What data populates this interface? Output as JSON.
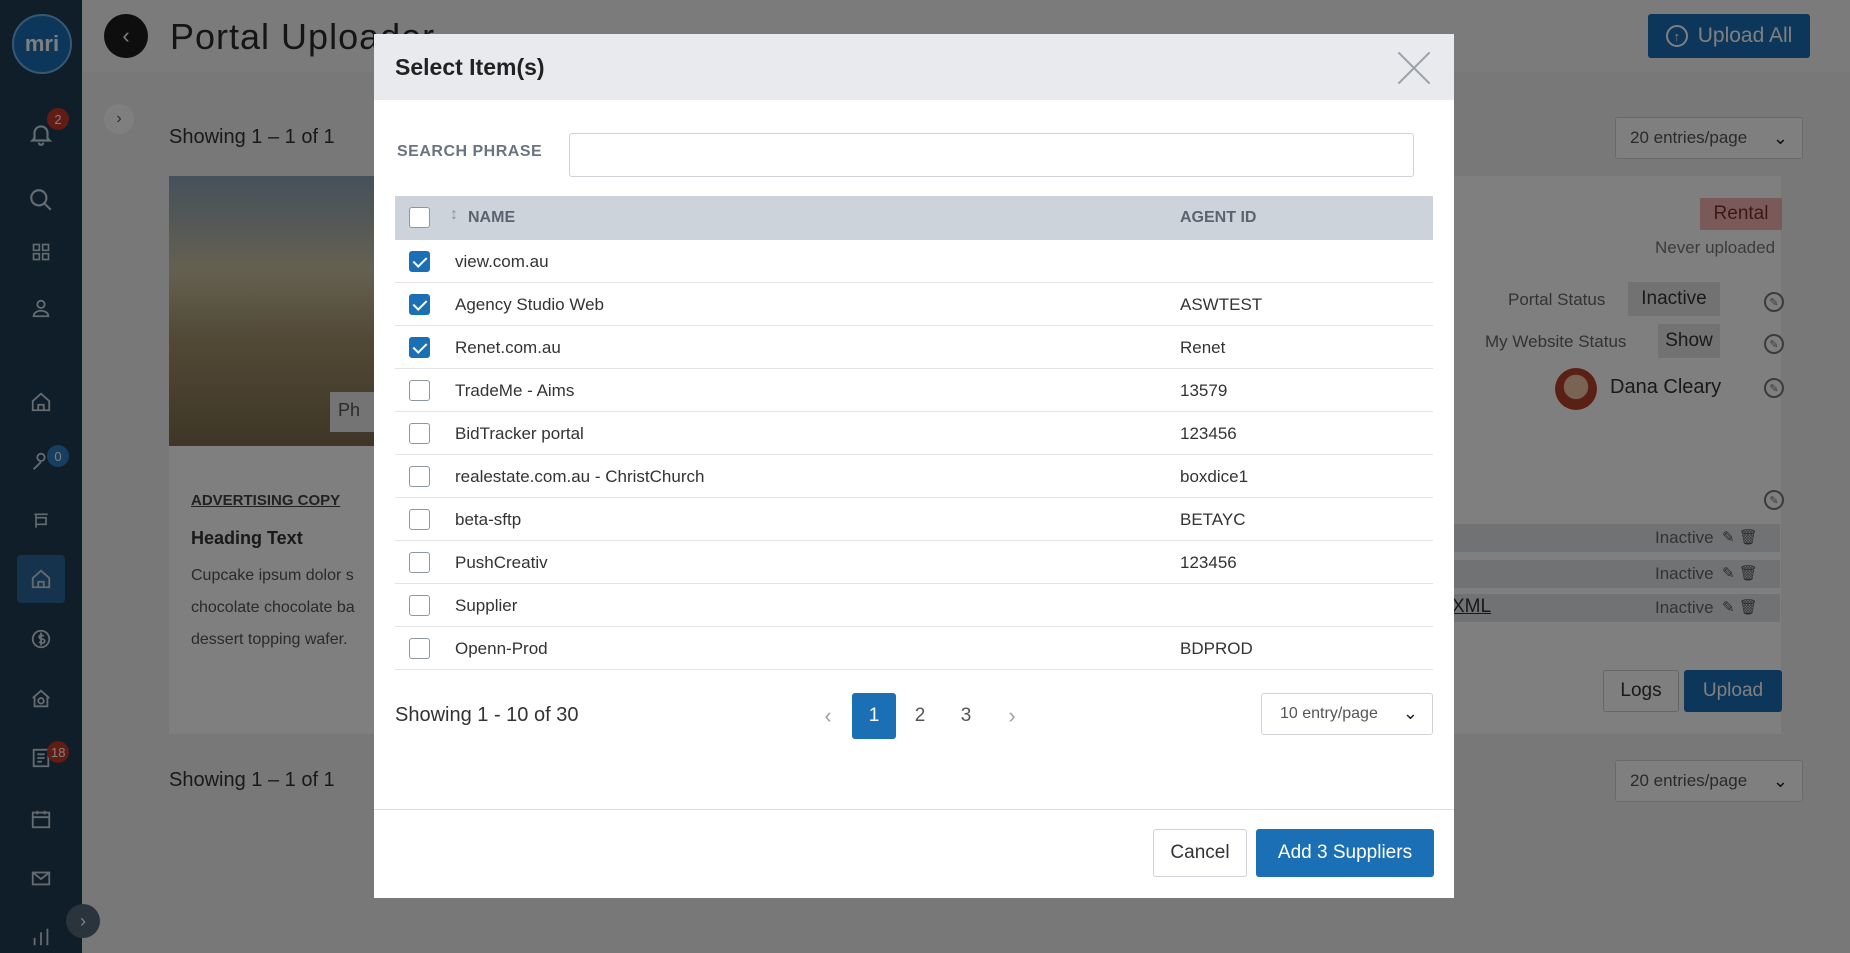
{
  "app": {
    "logo_text": "mri",
    "title": "Portal Uploader",
    "upload_all_label": "Upload All"
  },
  "sidebar": {
    "items": [
      {
        "name": "notifications",
        "icon": "bell-icon",
        "badge": "2"
      },
      {
        "name": "search",
        "icon": "search-icon"
      },
      {
        "name": "dashboard",
        "icon": "grid-icon"
      },
      {
        "name": "contacts",
        "icon": "user-icon"
      },
      {
        "name": "properties",
        "icon": "home-icon"
      },
      {
        "name": "prospects",
        "icon": "key-user-icon",
        "badge": "0"
      },
      {
        "name": "listings",
        "icon": "sign-icon"
      },
      {
        "name": "portals",
        "icon": "house-active-icon"
      },
      {
        "name": "finance",
        "icon": "dollar-icon"
      },
      {
        "name": "inspections",
        "icon": "house-search-icon"
      },
      {
        "name": "tasks",
        "icon": "task-list-icon",
        "badge": "18"
      },
      {
        "name": "calendar",
        "icon": "calendar-icon"
      },
      {
        "name": "mail",
        "icon": "mail-icon"
      },
      {
        "name": "reports",
        "icon": "bar-chart-icon"
      }
    ]
  },
  "page": {
    "showing_top": "Showing 1 – 1 of 1",
    "showing_bottom": "Showing 1 – 1 of 1",
    "entries_per_page": "20 entries/page",
    "photo_label": "Ph",
    "advertising_copy_label": "ADVERTISING COPY",
    "heading_text": "Heading Text",
    "body_text": "Cupcake ipsum dolor s chocolate chocolate ba dessert topping wafer.",
    "rental_tag": "Rental",
    "never_uploaded": "Never uploaded",
    "portal_status_label": "Portal Status",
    "portal_status_value": "Inactive",
    "website_status_label": "My Website Status",
    "website_status_value": "Show",
    "agent_name": "Dana Cleary",
    "portal_rows": [
      "Inactive",
      "Inactive",
      "Inactive"
    ],
    "xml_link": "XML",
    "logs_label": "Logs",
    "upload_label": "Upload"
  },
  "modal": {
    "title": "Select Item(s)",
    "search_label": "SEARCH PHRASE",
    "search_value": "",
    "columns": {
      "name": "NAME",
      "agent_id": "AGENT ID"
    },
    "rows": [
      {
        "name": "view.com.au",
        "agent_id": "",
        "checked": true
      },
      {
        "name": "Agency Studio Web",
        "agent_id": "ASWTEST",
        "checked": true
      },
      {
        "name": "Renet.com.au",
        "agent_id": "Renet",
        "checked": true
      },
      {
        "name": "TradeMe - Aims",
        "agent_id": "13579",
        "checked": false
      },
      {
        "name": "BidTracker portal",
        "agent_id": "123456",
        "checked": false
      },
      {
        "name": "realestate.com.au - ChristChurch",
        "agent_id": "boxdice1",
        "checked": false
      },
      {
        "name": "beta-sftp",
        "agent_id": "BETAYC",
        "checked": false
      },
      {
        "name": "PushCreativ",
        "agent_id": "123456",
        "checked": false
      },
      {
        "name": "Supplier",
        "agent_id": "",
        "checked": false
      },
      {
        "name": "Openn-Prod",
        "agent_id": "BDPROD",
        "checked": false
      }
    ],
    "showing": "Showing 1 - 10 of 30",
    "pages": [
      "1",
      "2",
      "3"
    ],
    "current_page": "1",
    "entry_per_page": "10 entry/page",
    "cancel_label": "Cancel",
    "add_label": "Add 3 Suppliers"
  },
  "colors": {
    "primary": "#1b6fb5",
    "sidebar": "#1e3d52",
    "badge": "#c0392b"
  }
}
